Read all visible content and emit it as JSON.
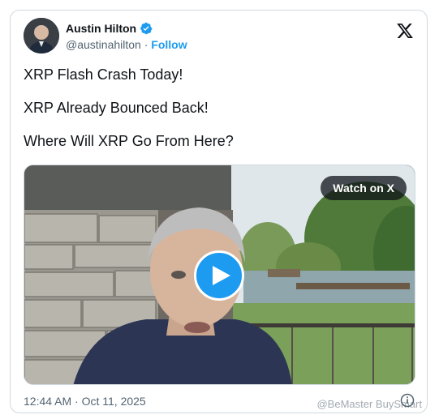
{
  "author": {
    "display_name": "Austin Hilton",
    "handle": "@austinahilton",
    "separator": "·",
    "follow_label": "Follow",
    "verified_color": "#1d9bf0"
  },
  "tweet": {
    "lines": [
      "XRP Flash Crash Today!",
      "XRP Already Bounced Back!",
      "Where Will XRP Go From Here?"
    ],
    "timestamp": "12:44 AM · Oct 11, 2025"
  },
  "media": {
    "type": "video",
    "watch_label": "Watch on X",
    "play_color": "#1d9bf0"
  },
  "icons": {
    "brand": "x-logo-icon",
    "verified": "verified-badge-icon",
    "info": "info-icon",
    "play": "play-icon"
  },
  "watermark": "@BeMaster BuySmart"
}
